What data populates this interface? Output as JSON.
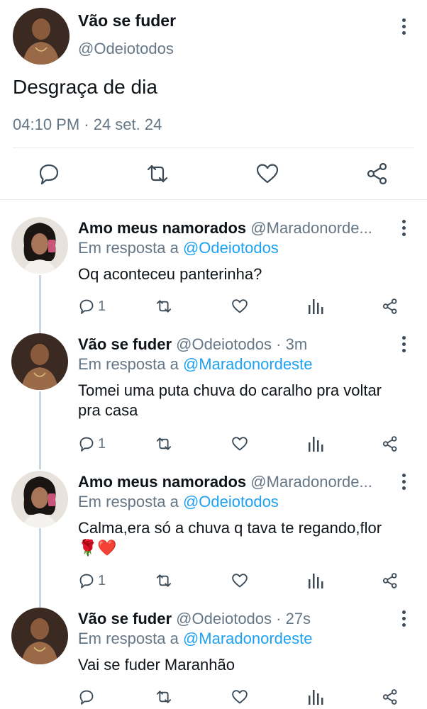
{
  "main_tweet": {
    "author_name": "Vão se fuder",
    "author_handle": "@Odeiotodos",
    "text": "Desgraça de dia",
    "meta": "04:10 PM · 24 set. 24",
    "actions": [
      "reply-icon",
      "retweet-icon",
      "like-icon",
      "share-icon"
    ]
  },
  "replies": [
    {
      "author_name": "Amo meus namorados",
      "author_handle": "@Maradonorde...",
      "replying_prefix": "Em resposta a ",
      "replying_to": "@Odeiotodos",
      "text_lines": [
        "Oq aconteceu panterinha?"
      ],
      "reply_count": "1"
    },
    {
      "author_name": "Vão se fuder",
      "author_handle": "@Odeiotodos · 3m",
      "replying_prefix": "Em resposta a ",
      "replying_to": "@Maradonordeste",
      "text_lines": [
        "Tomei uma puta chuva do caralho pra voltar",
        "pra casa"
      ],
      "reply_count": "1"
    },
    {
      "author_name": "Amo meus namorados",
      "author_handle": "@Maradonorde...",
      "replying_prefix": "Em resposta a ",
      "replying_to": "@Odeiotodos",
      "text_lines": [
        "Calma,era só a chuva q tava te regando,flor",
        "🌹❤️"
      ],
      "reply_count": "1"
    },
    {
      "author_name": "Vão se fuder",
      "author_handle": "@Odeiotodos · 27s",
      "replying_prefix": "Em resposta a ",
      "replying_to": "@Maradonordeste",
      "text_lines": [
        "Vai se fuder Maranhão"
      ],
      "reply_count": ""
    }
  ],
  "colors": {
    "accent": "#1da1f2",
    "text": "#0f1419",
    "secondary": "#657786",
    "divider": "#e6ecf0",
    "icon": "#3b4a56"
  }
}
